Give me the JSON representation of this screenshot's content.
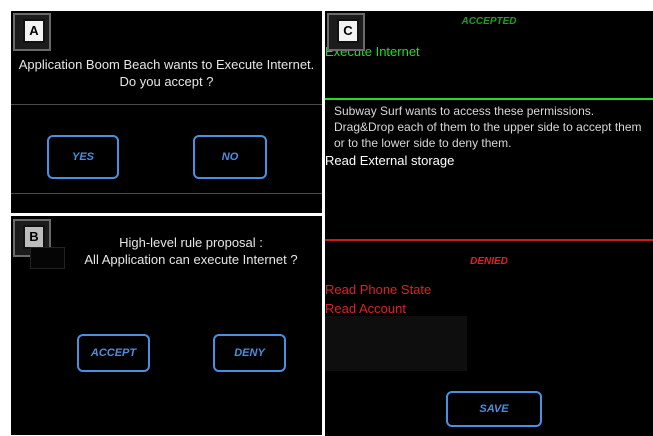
{
  "panel_a": {
    "badge": "A",
    "question_line1": "Application Boom Beach wants to Execute Internet.",
    "question_line2": "Do you accept ?",
    "yes_label": "YES",
    "no_label": "NO"
  },
  "panel_b": {
    "badge": "B",
    "question_line1": "High-level rule proposal :",
    "question_line2": "All Application can execute Internet ?",
    "accept_label": "ACCEPT",
    "deny_label": "DENY"
  },
  "panel_c": {
    "badge": "C",
    "accepted_header": "ACCEPTED",
    "accepted_permissions": [
      "Execute Internet"
    ],
    "instructions": "Subway Surf wants to access these permissions. Drag&Drop each of them to the upper side to accept them or to the lower side to deny them.",
    "pending_permissions": [
      "Read External storage"
    ],
    "denied_header": "DENIED",
    "denied_permissions": [
      "Read Phone State",
      "Read Account"
    ],
    "save_label": "SAVE"
  },
  "colors": {
    "background": "#000000",
    "button_blue": "#4a8fe0",
    "accepted_green": "#22dd22",
    "denied_red": "#dd2222"
  }
}
